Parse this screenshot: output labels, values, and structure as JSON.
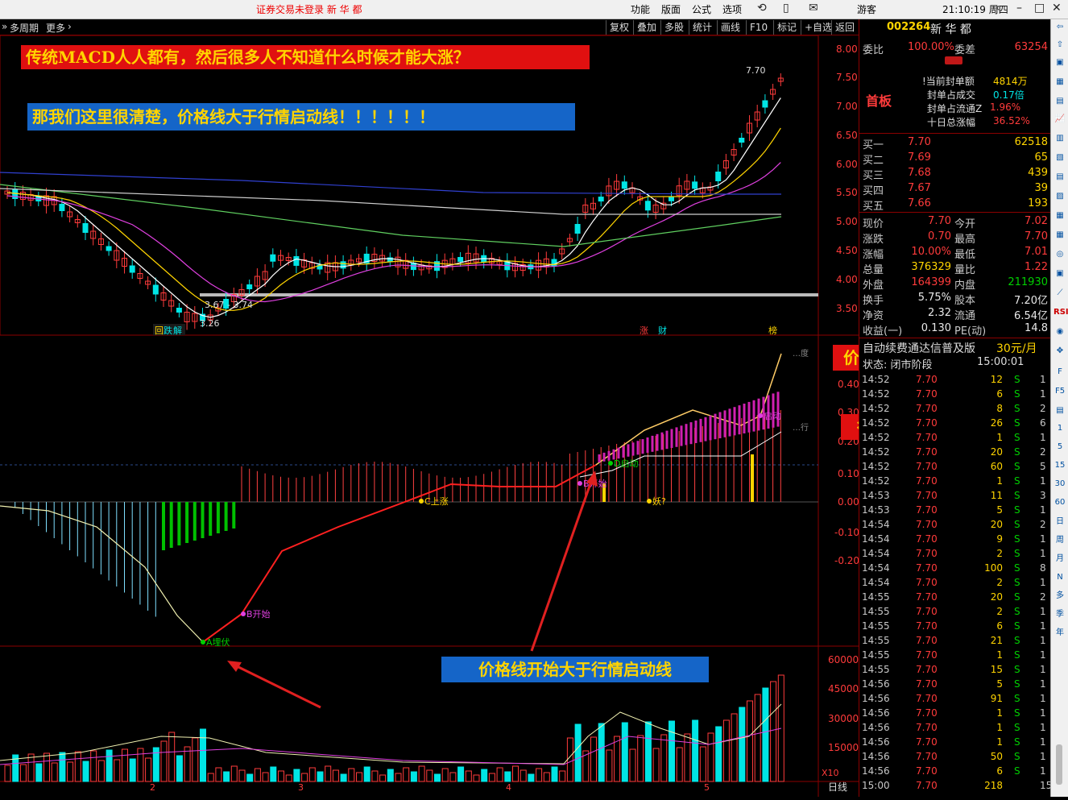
{
  "topbar": {
    "notice": "证券交易未登录  新 华 都",
    "menu": [
      "功能",
      "版面",
      "公式",
      "选项"
    ],
    "guest": "游客",
    "clock": "21:10:19 周四"
  },
  "toolbar": {
    "left": [
      "多周期",
      "更多"
    ],
    "buttons": [
      "复权",
      "叠加",
      "多股",
      "统计",
      "画线",
      "F10",
      "标记",
      "+自选",
      "返回"
    ]
  },
  "annotations": {
    "top1": "传统MACD人人都有，然后很多人不知道什么时候才能大涨？",
    "top2": "那我们这里很清楚，价格线大于行情启动线！！！！！！",
    "price_line": "价格线",
    "start_line": "行情启动线",
    "bottom": "价格线开始大于行情启动线"
  },
  "main_chart": {
    "price_axis": [
      "8.00",
      "7.50",
      "7.00",
      "6.50",
      "6.00",
      "5.50",
      "5.00",
      "4.50",
      "4.00",
      "3.50"
    ],
    "high_label": "7.70",
    "low_label": "3.26",
    "range_label": "3.67 - 3.74",
    "events": [
      "回",
      "跌",
      "解",
      "涨",
      "财",
      "榜"
    ]
  },
  "indicator_chart": {
    "axis": [
      "0.40",
      "0.30",
      "0.20",
      "0.10",
      "0.00",
      "-0.10",
      "-0.20"
    ],
    "tags": [
      "A埋伏",
      "B开始",
      "C上涨",
      "B开始",
      "D启动",
      "妖?",
      "启动"
    ],
    "cut_labels": [
      "…度",
      "…行"
    ]
  },
  "volume_chart": {
    "axis": [
      "60000",
      "45000",
      "30000",
      "15000"
    ],
    "unit": "X10",
    "x_ticks": [
      "2",
      "3",
      "4",
      "5"
    ],
    "period": "日线"
  },
  "quote": {
    "code": "002264",
    "name": "新 华 都",
    "weibi_label": "委比",
    "weibi": "100.00%",
    "weicha_label": "委差",
    "weicha": "63254",
    "board": "首板",
    "seal_info": [
      {
        "label": "!当前封单额",
        "value": "4814万"
      },
      {
        "label": "封单占成交",
        "value": "0.17倍"
      },
      {
        "label": "封单占流通Z",
        "value": "1.96%"
      },
      {
        "label": "十日总涨幅",
        "value": "36.52%"
      }
    ],
    "bids": [
      {
        "label": "买一",
        "price": "7.70",
        "vol": "62518"
      },
      {
        "label": "买二",
        "price": "7.69",
        "vol": "65"
      },
      {
        "label": "买三",
        "price": "7.68",
        "vol": "439"
      },
      {
        "label": "买四",
        "price": "7.67",
        "vol": "39"
      },
      {
        "label": "买五",
        "price": "7.66",
        "vol": "193"
      }
    ],
    "stats": [
      {
        "l1": "现价",
        "v1": "7.70",
        "l2": "今开",
        "v2": "7.02"
      },
      {
        "l1": "涨跌",
        "v1": "0.70",
        "l2": "最高",
        "v2": "7.70"
      },
      {
        "l1": "涨幅",
        "v1": "10.00%",
        "l2": "最低",
        "v2": "7.01"
      },
      {
        "l1": "总量",
        "v1": "376329",
        "l2": "量比",
        "v2": "1.22"
      },
      {
        "l1": "外盘",
        "v1": "164399",
        "l2": "内盘",
        "v2": "211930"
      },
      {
        "l1": "换手",
        "v1": "5.75%",
        "l2": "股本",
        "v2": "7.20亿"
      },
      {
        "l1": "净资",
        "v1": "2.32",
        "l2": "流通",
        "v2": "6.54亿"
      },
      {
        "l1": "收益(一)",
        "v1": "0.130",
        "l2": "PE(动)",
        "v2": "14.8"
      }
    ],
    "ad": "自动续费通达信普及版",
    "ad_price": "30元/月",
    "state_label": "状态: 闭市阶段",
    "state_time": "15:00:01"
  },
  "ticks": [
    {
      "t": "14:52",
      "p": "7.70",
      "v": "12",
      "s": "S",
      "n": "1"
    },
    {
      "t": "14:52",
      "p": "7.70",
      "v": "6",
      "s": "S",
      "n": "1"
    },
    {
      "t": "14:52",
      "p": "7.70",
      "v": "8",
      "s": "S",
      "n": "2"
    },
    {
      "t": "14:52",
      "p": "7.70",
      "v": "26",
      "s": "S",
      "n": "6"
    },
    {
      "t": "14:52",
      "p": "7.70",
      "v": "1",
      "s": "S",
      "n": "1"
    },
    {
      "t": "14:52",
      "p": "7.70",
      "v": "20",
      "s": "S",
      "n": "2"
    },
    {
      "t": "14:52",
      "p": "7.70",
      "v": "60",
      "s": "S",
      "n": "5"
    },
    {
      "t": "14:52",
      "p": "7.70",
      "v": "1",
      "s": "S",
      "n": "1"
    },
    {
      "t": "14:53",
      "p": "7.70",
      "v": "11",
      "s": "S",
      "n": "3"
    },
    {
      "t": "14:53",
      "p": "7.70",
      "v": "5",
      "s": "S",
      "n": "1"
    },
    {
      "t": "14:54",
      "p": "7.70",
      "v": "20",
      "s": "S",
      "n": "2"
    },
    {
      "t": "14:54",
      "p": "7.70",
      "v": "9",
      "s": "S",
      "n": "1"
    },
    {
      "t": "14:54",
      "p": "7.70",
      "v": "2",
      "s": "S",
      "n": "1"
    },
    {
      "t": "14:54",
      "p": "7.70",
      "v": "100",
      "s": "S",
      "n": "8"
    },
    {
      "t": "14:54",
      "p": "7.70",
      "v": "2",
      "s": "S",
      "n": "1"
    },
    {
      "t": "14:55",
      "p": "7.70",
      "v": "20",
      "s": "S",
      "n": "2"
    },
    {
      "t": "14:55",
      "p": "7.70",
      "v": "2",
      "s": "S",
      "n": "1"
    },
    {
      "t": "14:55",
      "p": "7.70",
      "v": "6",
      "s": "S",
      "n": "1"
    },
    {
      "t": "14:55",
      "p": "7.70",
      "v": "21",
      "s": "S",
      "n": "1"
    },
    {
      "t": "14:55",
      "p": "7.70",
      "v": "1",
      "s": "S",
      "n": "1"
    },
    {
      "t": "14:55",
      "p": "7.70",
      "v": "15",
      "s": "S",
      "n": "1"
    },
    {
      "t": "14:56",
      "p": "7.70",
      "v": "5",
      "s": "S",
      "n": "1"
    },
    {
      "t": "14:56",
      "p": "7.70",
      "v": "91",
      "s": "S",
      "n": "1"
    },
    {
      "t": "14:56",
      "p": "7.70",
      "v": "1",
      "s": "S",
      "n": "1"
    },
    {
      "t": "14:56",
      "p": "7.70",
      "v": "1",
      "s": "S",
      "n": "1"
    },
    {
      "t": "14:56",
      "p": "7.70",
      "v": "1",
      "s": "S",
      "n": "1"
    },
    {
      "t": "14:56",
      "p": "7.70",
      "v": "50",
      "s": "S",
      "n": "1"
    },
    {
      "t": "14:56",
      "p": "7.70",
      "v": "6",
      "s": "S",
      "n": "1"
    },
    {
      "t": "15:00",
      "p": "7.70",
      "v": "218",
      "s": "",
      "n": "15"
    }
  ],
  "sidebar": [
    "RSI",
    "1",
    "5",
    "15",
    "30",
    "60",
    "日",
    "周",
    "月",
    "N",
    "多",
    "季",
    "年"
  ],
  "colors": {
    "up": "#ff3b3b",
    "down": "#00e5e5",
    "bg": "#000000",
    "grid": "#8b0000"
  }
}
